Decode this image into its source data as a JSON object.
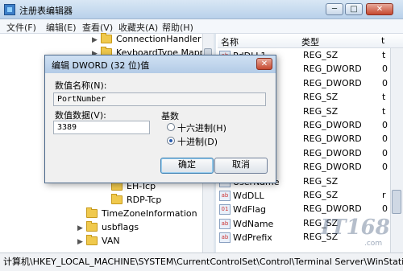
{
  "window": {
    "title": "注册表编辑器",
    "minimize": "─",
    "maximize": "□",
    "close": "✕"
  },
  "menu": [
    "文件(F)",
    "编辑(E)",
    "查看(V)",
    "收藏夹(A)",
    "帮助(H)"
  ],
  "tree": {
    "items": [
      {
        "label": "ConnectionHandler",
        "expander": "▶"
      },
      {
        "label": "KeyboardType Mappi",
        "expander": "▶"
      },
      {
        "label": "EH-Tcp",
        "expander": ""
      },
      {
        "label": "RDP-Tcp",
        "expander": ""
      },
      {
        "label": "TimeZoneInformation",
        "expander": ""
      },
      {
        "label": "usbflags",
        "expander": "▶"
      },
      {
        "label": "VAN",
        "expander": "▶"
      }
    ]
  },
  "list": {
    "headers": {
      "name": "名称",
      "type": "类型",
      "data": "t"
    },
    "rows": [
      {
        "name": "PdDLL1",
        "type": "REG_SZ",
        "data": "t"
      },
      {
        "name": "",
        "type": "REG_DWORD",
        "data": "0"
      },
      {
        "name": "",
        "type": "REG_DWORD",
        "data": "0"
      },
      {
        "name": "",
        "type": "REG_SZ",
        "data": "t"
      },
      {
        "name": "",
        "type": "REG_SZ",
        "data": "t"
      },
      {
        "name": "r",
        "type": "REG_DWORD",
        "data": "0"
      },
      {
        "name": "er",
        "type": "REG_DWORD",
        "data": "0"
      },
      {
        "name": "",
        "type": "REG_DWORD",
        "data": "0"
      },
      {
        "name": "ertifica...",
        "type": "REG_DWORD",
        "data": "0"
      },
      {
        "name": "UserName",
        "type": "REG_SZ",
        "data": ""
      },
      {
        "name": "WdDLL",
        "type": "REG_SZ",
        "data": "r"
      },
      {
        "name": "WdFlag",
        "type": "REG_DWORD",
        "data": "0"
      },
      {
        "name": "WdName",
        "type": "REG_SZ",
        "data": ""
      },
      {
        "name": "WdPrefix",
        "type": "REG_SZ",
        "data": ""
      }
    ]
  },
  "statusbar": {
    "path": "计算机\\HKEY_LOCAL_MACHINE\\SYSTEM\\CurrentControlSet\\Control\\Terminal Server\\WinStations\\R"
  },
  "dialog": {
    "title": "编辑 DWORD (32 位)值",
    "close": "✕",
    "name_label": "数值名称(N):",
    "name_value": "PortNumber",
    "data_label": "数值数据(V):",
    "data_value": "3389",
    "base_label": "基数",
    "hex_label": "十六进制(H)",
    "dec_label": "十进制(D)",
    "selected_base": "decimal",
    "ok": "确定",
    "cancel": "取消"
  },
  "watermark": {
    "text": "IT168",
    "sub": ".com"
  }
}
